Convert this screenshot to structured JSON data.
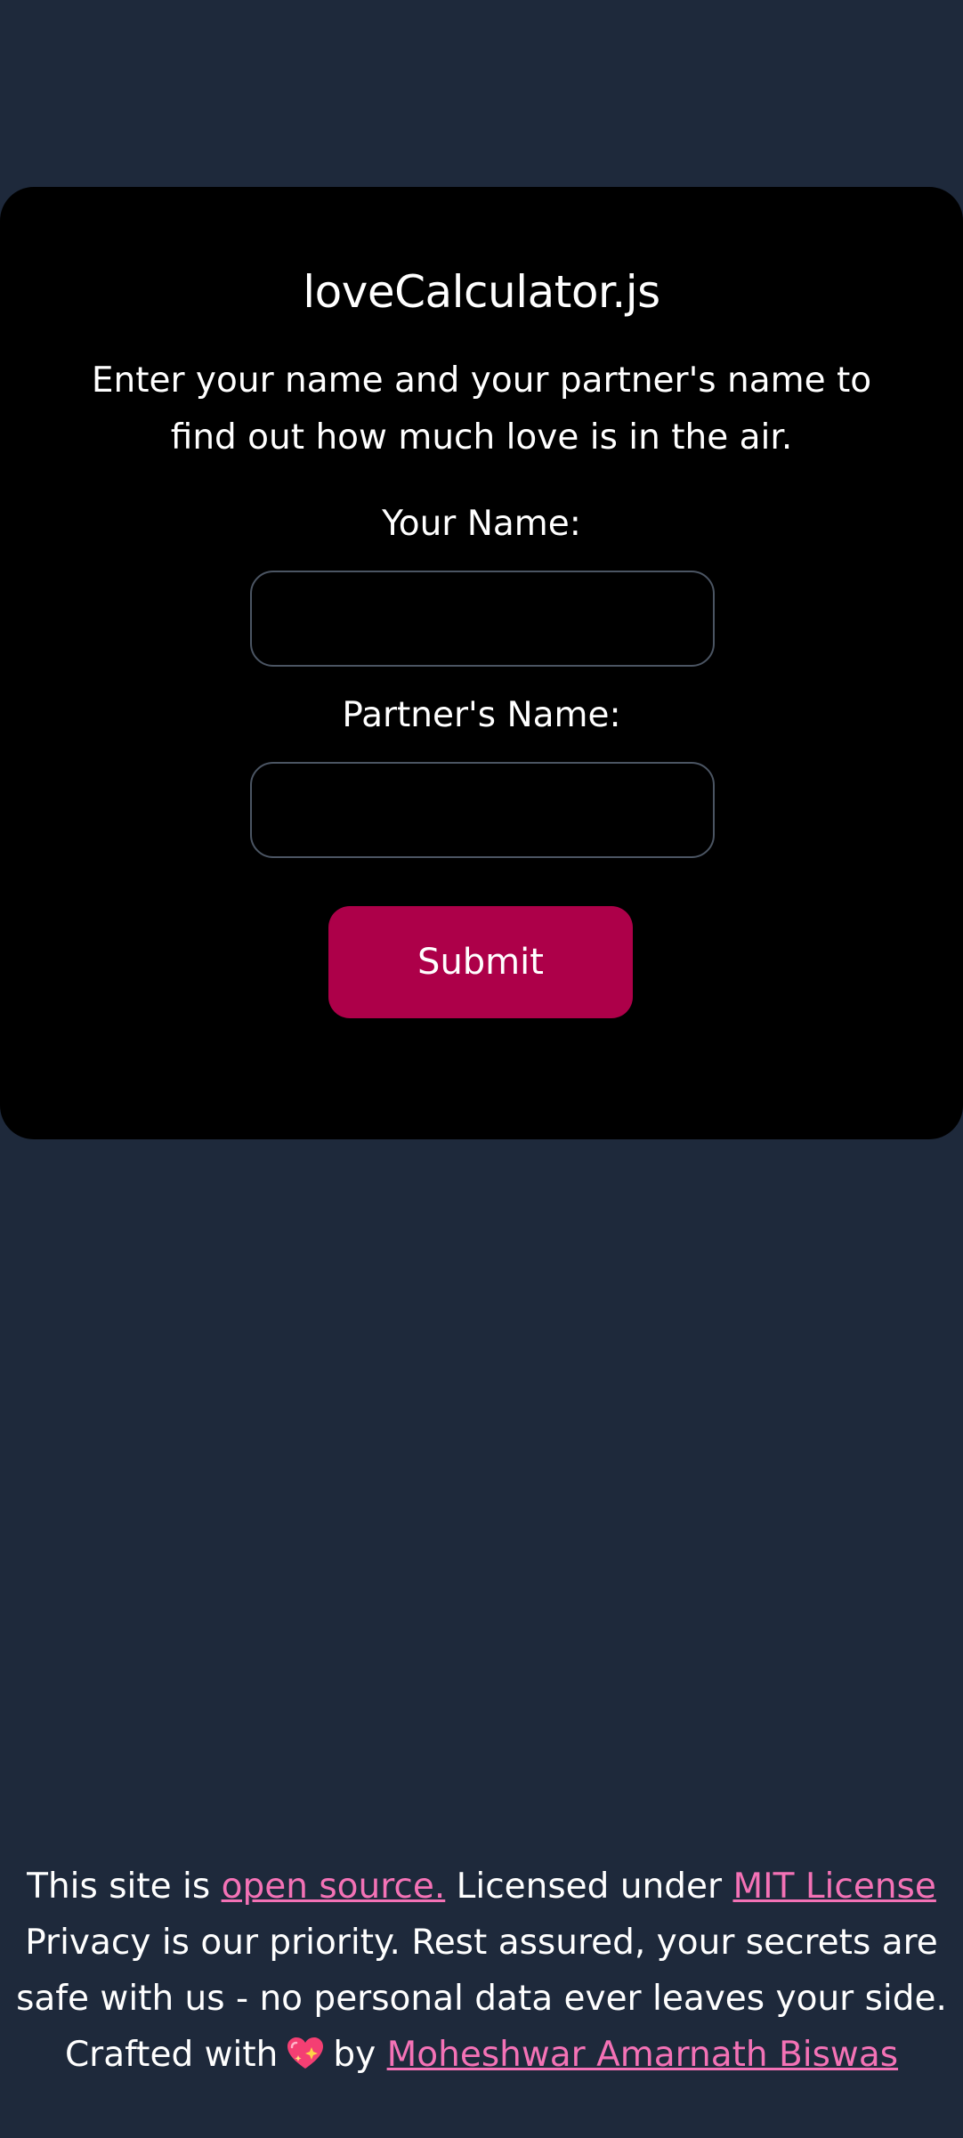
{
  "app": {
    "title": "loveCalculator.js",
    "intro": "Enter your name and your partner's name to find out how much love is in the air."
  },
  "form": {
    "your_name_label": "Your Name:",
    "your_name_value": "",
    "partner_name_label": "Partner's Name:",
    "partner_name_value": "",
    "submit_label": "Submit"
  },
  "footer": {
    "line1_prefix": "This site is ",
    "open_source_link": "open source.",
    "line1_middle": " Licensed under ",
    "license_link": "MIT License",
    "privacy_text": "Privacy is our priority. Rest assured, your secrets are safe with us - no personal data ever leaves your side.",
    "crafted_prefix": "Crafted with",
    "crafted_by": "by",
    "author_link": "Moheshwar Amarnath Biswas",
    "heart_icon": "sparkling-heart-icon"
  },
  "colors": {
    "page_background": "#1e293b",
    "card_background": "#000000",
    "accent_button": "#ad0049",
    "link": "#f472b6"
  }
}
